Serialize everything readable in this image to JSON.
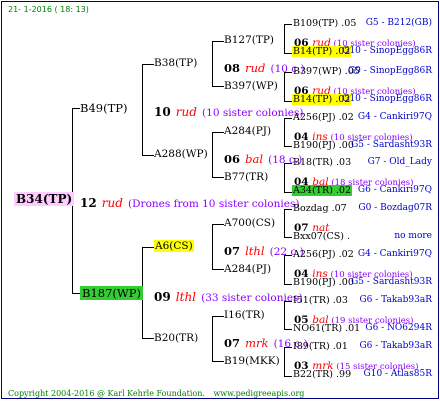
{
  "header": {
    "date": "21-  1-2016 ( 18: 13)"
  },
  "footer": {
    "copyright": "Copyright 2004-2016 @ Karl Kehrle Foundation.",
    "website": "www.pedigreeapis.org"
  },
  "colors": {
    "purple_text": "#8b00ff",
    "blue_text": "#0000cc",
    "red_text": "#ff0000",
    "highlight_yellow": "#ffff00",
    "highlight_green": "#33cc33",
    "highlight_pink": "#ffccff"
  },
  "root": {
    "id": "B34(TP)",
    "gen_num": "12",
    "gen_place": "rud",
    "note": "(Drones from 10 sister colonies)"
  },
  "gen1": {
    "top": {
      "id": "B49(TP)",
      "gen_num": "10",
      "gen_place": "rud",
      "note": "(10 sister colonies)"
    },
    "bottom": {
      "id": "B187(WP)",
      "gen_num": "09",
      "gen_place": "lthl",
      "note": "(33 sister colonies)"
    }
  },
  "gen2": {
    "b38": {
      "id": "B38(TP)",
      "gen_num": "08",
      "gen_place": "rud",
      "note": "(10 c.)"
    },
    "a288": {
      "id": "A288(WP)",
      "gen_num": "06",
      "gen_place": "bal",
      "note": "(18 c.)"
    },
    "a6": {
      "id": "A6(CS)",
      "gen_num": "07",
      "gen_place": "lthl",
      "note": "(22 c.)"
    },
    "b20": {
      "id": "B20(TR)",
      "gen_num": "07",
      "gen_place": "mrk",
      "note": "(16 c.)"
    }
  },
  "gen3": {
    "b127": "B127(TP)",
    "b397": "B397(WP)",
    "a284a": "A284(PJ)",
    "b77": "B77(TR)",
    "a700": "A700(CS)",
    "a284b": "A284(PJ)",
    "i16": "I16(TR)",
    "b19": "B19(MKK)"
  },
  "gen4": [
    {
      "id": "B109(TP)",
      "val": ".05",
      "ref": "G5 - B212(GB)",
      "hl": ""
    },
    {
      "num": "06",
      "place": "rud",
      "note": "(10 sister colonies)"
    },
    {
      "id": "B14(TP)",
      "val": ".02",
      "ref": "G10 - SinopEgg86R",
      "hl": "yellow"
    },
    {
      "id": "B397(WP)",
      "val": ".05",
      "ref": "G9 - SinopEgg86R",
      "hl": ""
    },
    {
      "num": "06",
      "place": "rud",
      "note": "(10 sister colonies)"
    },
    {
      "id": "B14(TP)",
      "val": ".02",
      "ref": "G10 - SinopEgg86R",
      "hl": "yellow"
    },
    {
      "id": "A256(PJ)",
      "val": ".02",
      "ref": "G4 - Cankiri97Q",
      "hl": ""
    },
    {
      "num": "04",
      "place": "ins",
      "note": "(10 sister colonies)"
    },
    {
      "id": "B190(PJ)",
      "val": ".00",
      "ref": "G5 - Sardasht93R",
      "hl": ""
    },
    {
      "id": "B18(TR)",
      "val": ".03",
      "ref": "G7 - Old_Lady",
      "hl": ""
    },
    {
      "num": "04",
      "place": "bal",
      "note": "(18 sister colonies)"
    },
    {
      "id": "A34(TR)",
      "val": ".02",
      "ref": "G6 - Cankiri97Q",
      "hl": "green"
    },
    {
      "id": "Bozdag",
      "val": ".07",
      "ref": "G0 - Bozdag07R",
      "hl": ""
    },
    {
      "num": "07",
      "place": "nat",
      "note": ""
    },
    {
      "id": "Bxx07(CS)",
      "val": ".",
      "ref": "no more",
      "hl": ""
    },
    {
      "id": "A256(PJ)",
      "val": ".02",
      "ref": "G4 - Cankiri97Q",
      "hl": ""
    },
    {
      "num": "04",
      "place": "ins",
      "note": "(10 sister colonies)"
    },
    {
      "id": "B190(PJ)",
      "val": ".00",
      "ref": "G5 - Sardasht93R",
      "hl": ""
    },
    {
      "id": "I51(TR)",
      "val": ".03",
      "ref": "G6 - Takab93aR",
      "hl": ""
    },
    {
      "num": "05",
      "place": "bal",
      "note": "(19 sister colonies)"
    },
    {
      "id": "NO61(TR)",
      "val": ".01",
      "ref": "G6 - NO6294R",
      "hl": ""
    },
    {
      "id": "I89(TR)",
      "val": ".01",
      "ref": "G6 - Takab93aR",
      "hl": ""
    },
    {
      "num": "03",
      "place": "mrk",
      "note": "(15 sister colonies)"
    },
    {
      "id": "B22(TR)",
      "val": ".99",
      "ref": "G10 - Atlas85R",
      "hl": ""
    }
  ]
}
